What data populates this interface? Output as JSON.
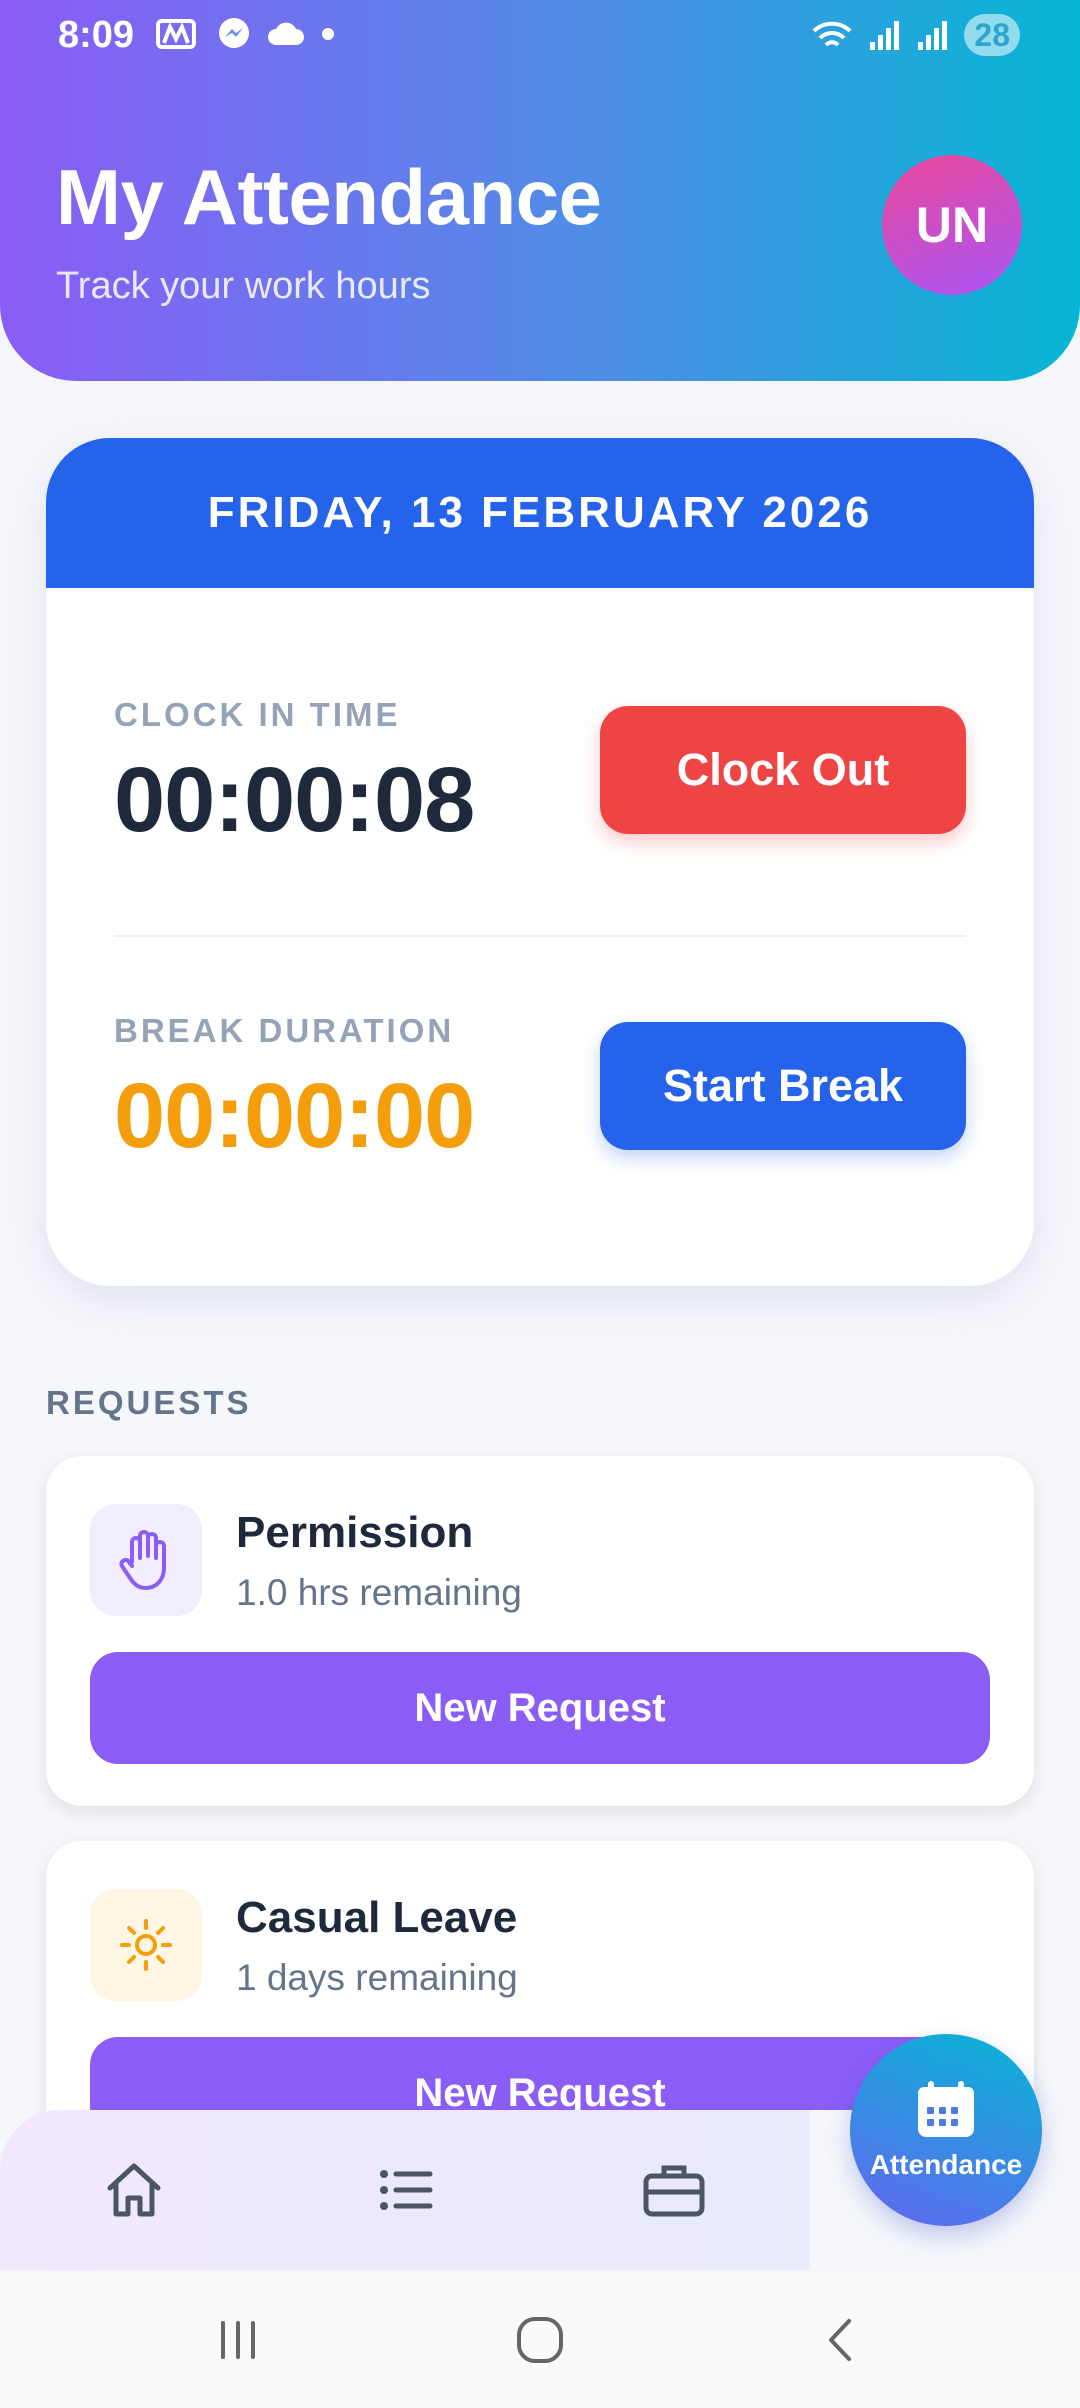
{
  "status_bar": {
    "time": "8:09",
    "battery": "28",
    "left_icons": [
      "m-app-icon",
      "messenger-icon",
      "cloud-icon",
      "dot-icon"
    ],
    "right_icons": [
      "wifi-icon",
      "signal-icon",
      "signal-icon"
    ]
  },
  "header": {
    "title": "My Attendance",
    "subtitle": "Track your work hours",
    "avatar_initials": "UN"
  },
  "attendance_card": {
    "date": "FRIDAY, 13 FEBRUARY 2026",
    "clock_in_label": "CLOCK IN TIME",
    "clock_in_value": "00:00:08",
    "clock_out_button": "Clock Out",
    "break_label": "BREAK DURATION",
    "break_value": "00:00:00",
    "start_break_button": "Start Break"
  },
  "requests": {
    "section_label": "REQUESTS",
    "items": [
      {
        "title": "Permission",
        "remaining": "1.0 hrs remaining",
        "button": "New Request",
        "icon": "hand-icon"
      },
      {
        "title": "Casual Leave",
        "remaining": "1 days remaining",
        "button": "New Request",
        "icon": "sun-icon"
      }
    ]
  },
  "bottom_nav": {
    "items": [
      "home-icon",
      "list-icon",
      "briefcase-icon"
    ],
    "active_label": "Attendance",
    "active_icon": "calendar-icon"
  },
  "colors": {
    "accent_blue": "#2563eb",
    "clock_out_red": "#ef4444",
    "break_amber": "#f59e0b",
    "request_purple": "#8b5cf6"
  }
}
